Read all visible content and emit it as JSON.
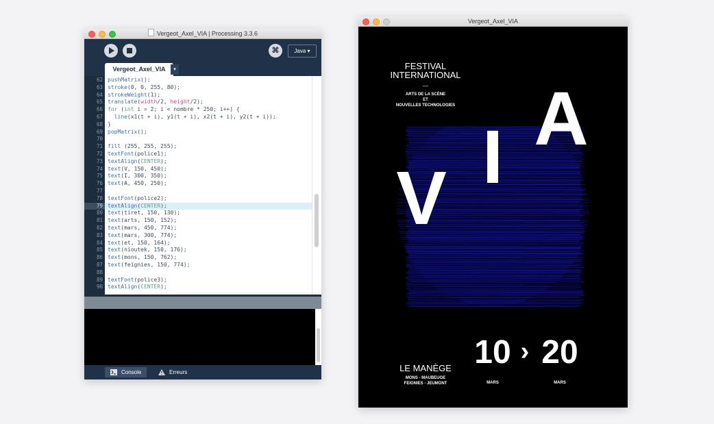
{
  "ide_window": {
    "title": "Vergeot_Axel_VIA | Processing 3.3.6",
    "mode": "Java ▾",
    "tab_label": "Vergeot_Axel_VIA",
    "tab_menu": "▾",
    "debug_glyph": "⌘",
    "footer_tabs": [
      "Console",
      "Erreurs"
    ],
    "highlighted_line": 79,
    "code_lines": [
      {
        "n": "62",
        "t": "pushMatrix();"
      },
      {
        "n": "63",
        "t": "stroke(0, 0, 255, 80);"
      },
      {
        "n": "64",
        "t": "strokeWeight(1);"
      },
      {
        "n": "65",
        "t": "translate(width/2, height/2);"
      },
      {
        "n": "66",
        "t": "for (int i = 2; i < nombre * 250; i++) {"
      },
      {
        "n": "67",
        "t": "  line(x1(t + i), y1(t + i), x2(t + i), y2(t + i));"
      },
      {
        "n": "68",
        "t": "}"
      },
      {
        "n": "69",
        "t": "popMatrix();"
      },
      {
        "n": "70",
        "t": ""
      },
      {
        "n": "71",
        "t": "fill (255, 255, 255);"
      },
      {
        "n": "72",
        "t": "textFont(police1);"
      },
      {
        "n": "73",
        "t": "textAlign(CENTER);"
      },
      {
        "n": "74",
        "t": "text(V, 150, 450);"
      },
      {
        "n": "75",
        "t": "text(I, 300, 350);"
      },
      {
        "n": "76",
        "t": "text(A, 450, 250);"
      },
      {
        "n": "77",
        "t": ""
      },
      {
        "n": "78",
        "t": "textFont(police2);"
      },
      {
        "n": "79",
        "t": "textAlign(CENTER);"
      },
      {
        "n": "80",
        "t": "text(tiret, 150, 130);"
      },
      {
        "n": "81",
        "t": "text(arts, 150, 152);"
      },
      {
        "n": "82",
        "t": "text(mars, 450, 774);"
      },
      {
        "n": "83",
        "t": "text(mars, 300, 774);"
      },
      {
        "n": "84",
        "t": "text(et, 150, 164);"
      },
      {
        "n": "85",
        "t": "text(nioutek, 150, 176);"
      },
      {
        "n": "86",
        "t": "text(mons, 150, 762);"
      },
      {
        "n": "87",
        "t": "text(feignies, 150, 774);"
      },
      {
        "n": "88",
        "t": ""
      },
      {
        "n": "89",
        "t": "textFont(police3);"
      },
      {
        "n": "90",
        "t": "textAlign(CENTER);"
      }
    ]
  },
  "sketch_window": {
    "title": "Vergeot_Axel_VIA",
    "poster": {
      "festival": "FESTIVAL",
      "international": "INTERNATIONAL",
      "dash": "—",
      "arts": "ARTS DE LA SCÈNE",
      "et": "ET",
      "nouvelles": "NOUVELLES TECHNOLOGIES",
      "letter_v": "V",
      "letter_i": "I",
      "letter_a": "A",
      "venue": "LE MANÈGE",
      "cities1": "MONS - MAUBEUGE",
      "cities2": "FEIGNIES - JEUMONT",
      "day_start": "10",
      "arrow": "›",
      "day_end": "20",
      "month_start": "MARS",
      "month_end": "MARS",
      "line_color": "#1a1aff",
      "background": "#000000"
    }
  }
}
